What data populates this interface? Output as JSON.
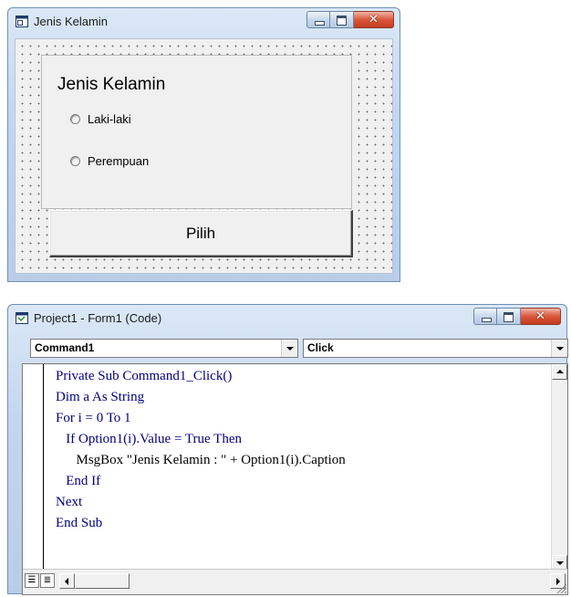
{
  "form_window": {
    "title": "Jenis Kelamin",
    "frame_caption": "Jenis Kelamin",
    "options": [
      "Laki-laki",
      "Perempuan"
    ],
    "command_caption": "Pilih"
  },
  "code_window": {
    "title": "Project1 - Form1 (Code)",
    "object_combo": "Command1",
    "procedure_combo": "Click",
    "code_lines": [
      "Private Sub Command1_Click()",
      "Dim a As String",
      "For i = 0 To 1",
      "   If Option1(i).Value = True Then",
      "      MsgBox \"Jenis Kelamin : \" + Option1(i).Caption",
      "   End If",
      "Next",
      "End Sub"
    ]
  },
  "colors": {
    "keyword": "#000080",
    "close_button": "#c43b1f",
    "title_bar": "#c3d6ee"
  }
}
